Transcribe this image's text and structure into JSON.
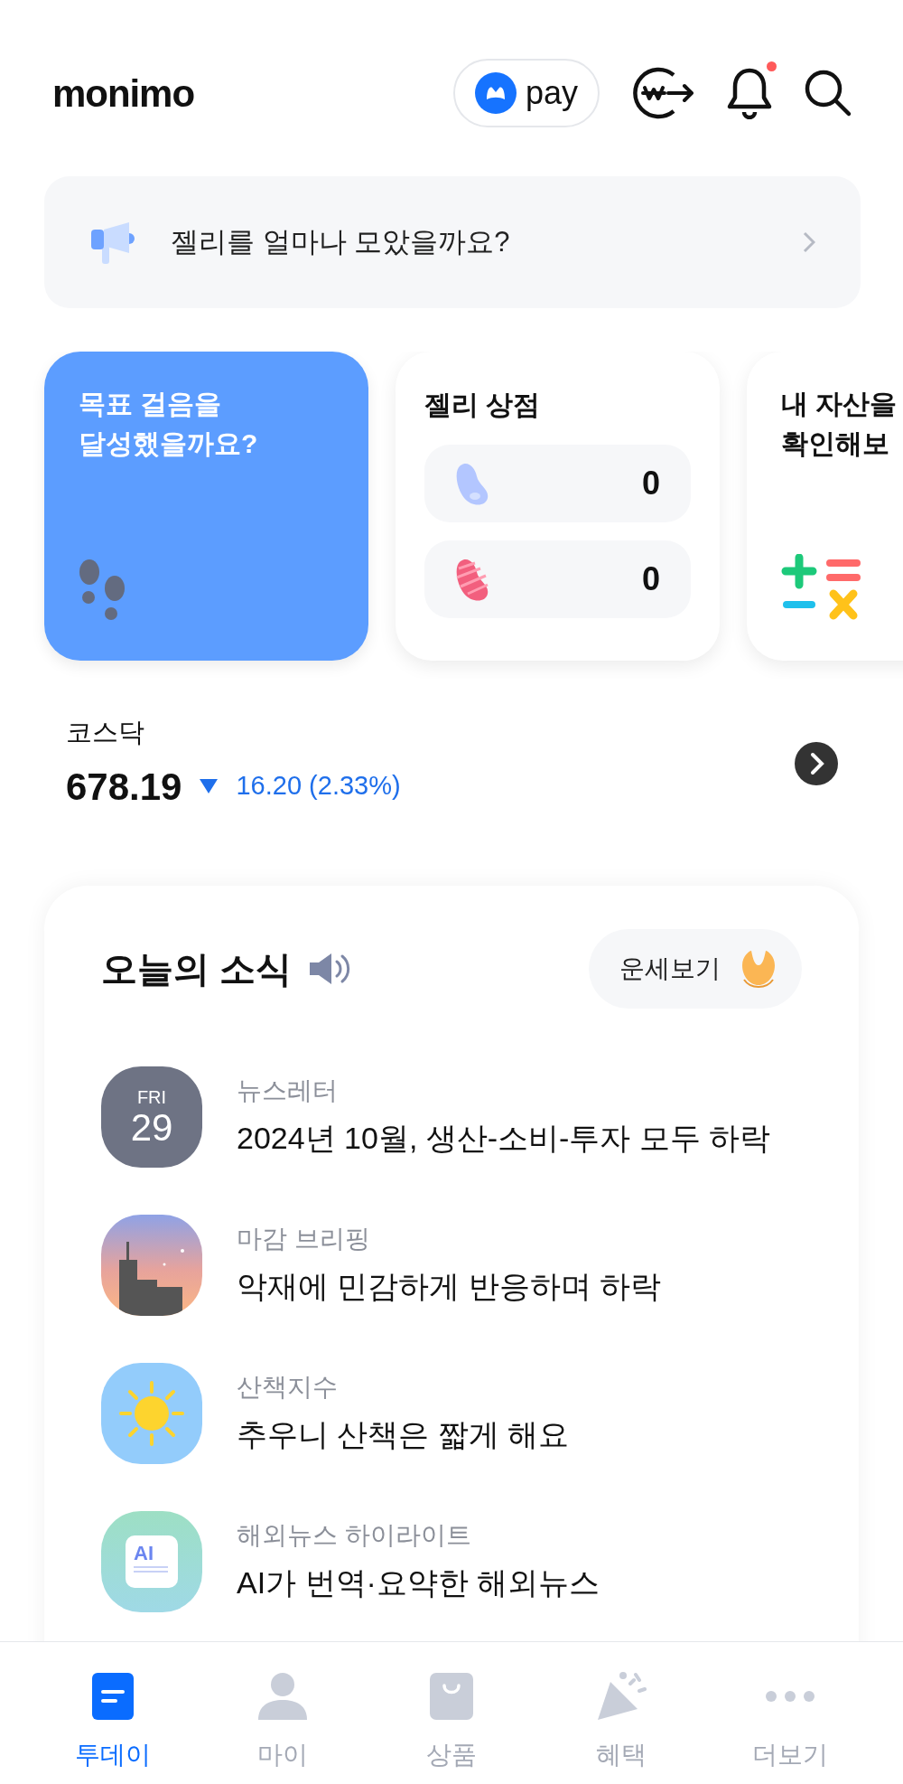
{
  "header": {
    "logo": "monimo",
    "pay_label": "pay",
    "notifications_unread": true
  },
  "banner": {
    "text": "젤리를 얼마나 모았을까요?"
  },
  "cards": [
    {
      "kind": "steps",
      "lines": [
        "목표 걸음을",
        "달성했을까요?"
      ]
    },
    {
      "kind": "jelly",
      "title": "젤리 상점",
      "rows": [
        {
          "kind": "blue",
          "count": "0"
        },
        {
          "kind": "red",
          "count": "0"
        }
      ]
    },
    {
      "kind": "assets",
      "lines": [
        "내 자산을",
        "확인해보"
      ]
    }
  ],
  "index": {
    "name": "코스닥",
    "value": "678.19",
    "falling": true,
    "change": "16.20 (2.33%)"
  },
  "news": {
    "title": "오늘의 소식",
    "fortune_button": "운세보기",
    "items": [
      {
        "kind": "date",
        "day": "FRI",
        "date": "29",
        "category": "뉴스레터",
        "headline": "2024년 10월, 생산-소비-투자 모두 하락"
      },
      {
        "kind": "city",
        "category": "마감 브리핑",
        "headline": "악재에 민감하게 반응하며 하락"
      },
      {
        "kind": "sun",
        "category": "산책지수",
        "headline": "추우니 산책은 짧게 해요"
      },
      {
        "kind": "ai",
        "badge": "AI",
        "category": "해외뉴스 하이라이트",
        "headline": "AI가 번역·요약한 해외뉴스"
      }
    ]
  },
  "tabs": [
    {
      "kind": "today",
      "label": "투데이",
      "selected": true
    },
    {
      "kind": "my",
      "label": "마이",
      "selected": false
    },
    {
      "kind": "products",
      "label": "상품",
      "selected": false
    },
    {
      "kind": "benefits",
      "label": "혜택",
      "selected": false
    },
    {
      "kind": "more",
      "label": "더보기",
      "selected": false
    }
  ]
}
